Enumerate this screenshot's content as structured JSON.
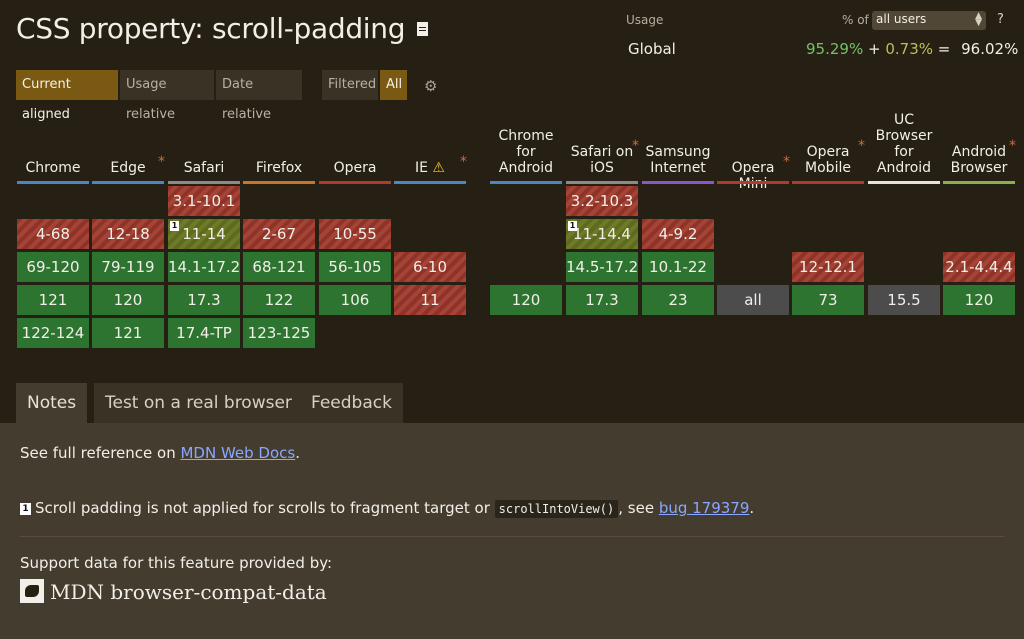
{
  "title": "CSS property: scroll-padding",
  "usage": {
    "label": "Usage",
    "percent_of": "% of",
    "select_value": "all users",
    "help": "?",
    "region": "Global",
    "full": "95.29%",
    "plus": "+",
    "partial": "0.73%",
    "equals": "=",
    "total": "96.02%"
  },
  "view_buttons": {
    "current_aligned": "Current aligned",
    "usage_relative": "Usage relative",
    "date_relative": "Date relative",
    "filtered": "Filtered",
    "all": "All"
  },
  "browsers": [
    {
      "key": "chrome",
      "l1": "Chrome",
      "l2": "",
      "l3": "",
      "l4": "",
      "star": false,
      "warn": false,
      "color": "#4a86c5"
    },
    {
      "key": "edge",
      "l1": "Edge",
      "l2": "",
      "l3": "",
      "l4": "",
      "star": true,
      "warn": false,
      "color": "#4a86c5"
    },
    {
      "key": "safari",
      "l1": "Safari",
      "l2": "",
      "l3": "",
      "l4": "",
      "star": false,
      "warn": false,
      "color": "#8a8a8a"
    },
    {
      "key": "firefox",
      "l1": "Firefox",
      "l2": "",
      "l3": "",
      "l4": "",
      "star": false,
      "warn": false,
      "color": "#c8742c"
    },
    {
      "key": "opera",
      "l1": "Opera",
      "l2": "",
      "l3": "",
      "l4": "",
      "star": false,
      "warn": false,
      "color": "#b03a32"
    },
    {
      "key": "ie",
      "l1": "IE",
      "l2": "",
      "l3": "",
      "l4": "",
      "star": true,
      "warn": true,
      "color": "#4a86c5"
    },
    {
      "key": "chrome-android",
      "l1": "Chrome",
      "l2": "for",
      "l3": "Android",
      "l4": "",
      "star": false,
      "warn": false,
      "color": "#4a86c5"
    },
    {
      "key": "safari-ios",
      "l1": "Safari on",
      "l2": "iOS",
      "l3": "",
      "l4": "",
      "star": true,
      "warn": false,
      "color": "#8a8a8a"
    },
    {
      "key": "samsung",
      "l1": "Samsung",
      "l2": "Internet",
      "l3": "",
      "l4": "",
      "star": false,
      "warn": false,
      "color": "#8b56c8"
    },
    {
      "key": "opera-mini",
      "l1": "Opera Mini",
      "l2": "",
      "l3": "",
      "l4": "",
      "star": true,
      "warn": false,
      "color": "#b03a32"
    },
    {
      "key": "opera-mobile",
      "l1": "Opera",
      "l2": "Mobile",
      "l3": "",
      "l4": "",
      "star": true,
      "warn": false,
      "color": "#b03a32"
    },
    {
      "key": "uc",
      "l1": "UC",
      "l2": "Browser",
      "l3": "for",
      "l4": "Android",
      "star": false,
      "warn": false,
      "color": "#e8e3d8"
    },
    {
      "key": "android",
      "l1": "Android",
      "l2": "Browser",
      "l3": "",
      "l4": "",
      "star": true,
      "warn": false,
      "color": "#8ab04a"
    }
  ],
  "cells": {
    "chrome": [
      "",
      "4-68",
      "69-120",
      "121",
      "122-124"
    ],
    "edge": [
      "",
      "12-18",
      "79-119",
      "120",
      "121"
    ],
    "safari": [
      "3.1-10.1",
      "11-14",
      "14.1-17.2",
      "17.3",
      "17.4-TP"
    ],
    "firefox": [
      "",
      "2-67",
      "68-121",
      "122",
      "123-125"
    ],
    "opera": [
      "",
      "10-55",
      "56-105",
      "106",
      ""
    ],
    "ie": [
      "",
      "",
      "6-10",
      "11",
      ""
    ],
    "chrome-android": [
      "",
      "",
      "",
      "120",
      ""
    ],
    "safari-ios": [
      "3.2-10.3",
      "11-14.4",
      "14.5-17.2",
      "17.3",
      ""
    ],
    "samsung": [
      "",
      "4-9.2",
      "10.1-22",
      "23",
      ""
    ],
    "opera-mini": [
      "",
      "",
      "",
      "all",
      ""
    ],
    "opera-mobile": [
      "",
      "",
      "12-12.1",
      "73",
      ""
    ],
    "uc": [
      "",
      "",
      "",
      "15.5",
      ""
    ],
    "android": [
      "",
      "",
      "2.1-4.4.4",
      "120",
      ""
    ]
  },
  "note_badge": "1",
  "tabs": {
    "notes": "Notes",
    "test": "Test on a real browser",
    "feedback": "Feedback"
  },
  "notes": {
    "ref_prefix": "See full reference on ",
    "ref_link": "MDN Web Docs",
    "ref_suffix": ".",
    "note1_text": "Scroll padding is not applied for scrolls to fragment target or ",
    "note1_code": "scrollIntoView()",
    "note1_mid": ", see ",
    "note1_link": "bug 179379",
    "note1_end": ".",
    "support_label": "Support data for this feature provided by:",
    "mdn_label": "MDN browser-compat-data"
  }
}
